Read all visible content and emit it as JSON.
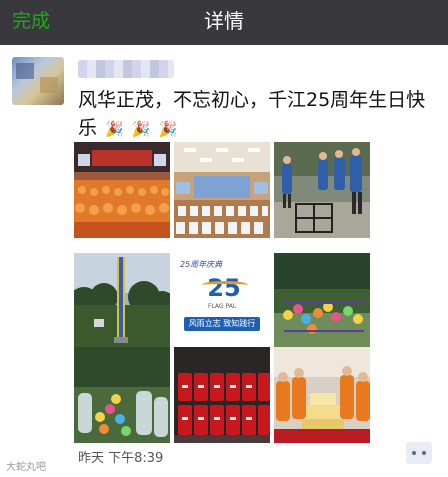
{
  "navbar": {
    "done_label": "完成",
    "title": "详情"
  },
  "post": {
    "text": "风华正茂，不忘初心，千江25周年生日快乐",
    "emoji_icon": "party-popper-icon",
    "time": "昨天  下午8:39"
  },
  "photos": [
    {
      "name": "photo-conference-hall-orange"
    },
    {
      "name": "photo-auditorium-white-chairs"
    },
    {
      "name": "photo-team-activity-blue"
    },
    {
      "name": "photo-tower-in-trees"
    },
    {
      "name": "photo-anniversary-poster",
      "poster_top": "25周年庆典",
      "poster_logo_number": "25",
      "poster_logo_sub": "FLAG PAL",
      "poster_banner": "风雨立志 致知践行"
    },
    {
      "name": "photo-balloons-outdoor"
    },
    {
      "name": "photo-crowd-balloons-forest"
    },
    {
      "name": "photo-red-cans-25"
    },
    {
      "name": "photo-birthday-cake-celebration"
    }
  ],
  "watermark": "大蛇丸吧"
}
